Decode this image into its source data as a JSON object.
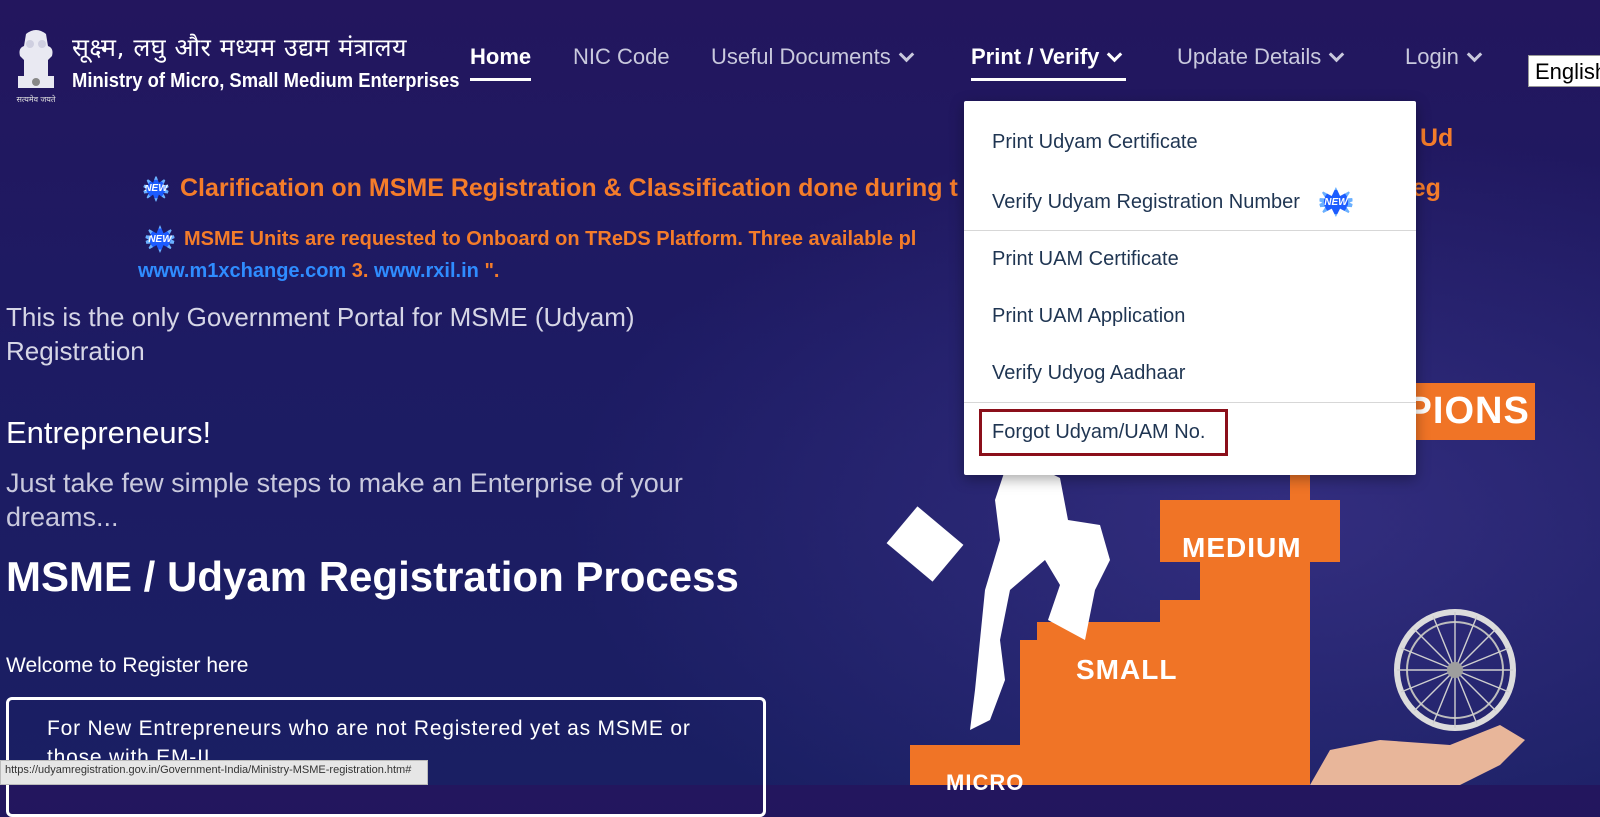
{
  "header": {
    "ministry_hindi": "सूक्ष्म, लघु और मध्यम उद्यम मंत्रालय",
    "ministry_english": "Ministry of Micro, Small Medium Enterprises",
    "emblem_caption": "सत्यमेव जयते",
    "language": "English"
  },
  "nav": {
    "items": [
      {
        "label": "Home",
        "active": true
      },
      {
        "label": "NIC Code"
      },
      {
        "label": "Useful Documents",
        "icon": "chevron-down-icon"
      },
      {
        "label": "Print / Verify",
        "active": true,
        "icon": "chevron-down-icon"
      },
      {
        "label": "Update Details",
        "icon": "chevron-down-icon"
      },
      {
        "label": "Login",
        "icon": "chevron-down-icon"
      }
    ]
  },
  "dropdown": {
    "items": [
      {
        "label": "Print Udyam Certificate"
      },
      {
        "label": "Verify Udyam Registration Number",
        "badge": "NEW"
      },
      {
        "label": "Print UAM Certificate"
      },
      {
        "label": "Print UAM Application"
      },
      {
        "label": "Verify Udyog Aadhaar"
      },
      {
        "label": "Forgot Udyam/UAM No.",
        "highlighted": true
      }
    ]
  },
  "announcements": {
    "badge_new": "NEW",
    "line1": "Clarification on MSME Registration & Classification done during t",
    "line1_tail": "reg",
    "line0_tail": "Ud",
    "line2": "MSME Units are requested to Onboard on TReDS Platform. Three available pl",
    "link2": "www.m1xchange.com",
    "link2_prefix": "3.",
    "link3": "www.rxil.in",
    "link3_suffix": "\"."
  },
  "main": {
    "portal_text": "This is the only Government Portal for MSME (Udyam) Registration",
    "entrepreneurs": "Entrepreneurs!",
    "simple_steps": "Just take few simple steps to make an Enterprise of your dreams...",
    "process_title": "MSME / Udyam Registration Process",
    "welcome": "Welcome to Register here",
    "new_entrepreneurs_box": "For New Entrepreneurs who are not Registered yet as MSME or those with EM-II"
  },
  "graphic": {
    "steps": [
      "MICRO",
      "SMALL",
      "MEDIUM"
    ],
    "top_label": "IPIONS"
  },
  "status_bar": {
    "url": "https://udyamregistration.gov.in/Government-India/Ministry-MSME-registration.htm#"
  },
  "colors": {
    "background": "#1d1b63",
    "accent_orange": "#f47c2a",
    "link_blue": "#2f8cff",
    "highlight_border": "#8b0f1a"
  }
}
